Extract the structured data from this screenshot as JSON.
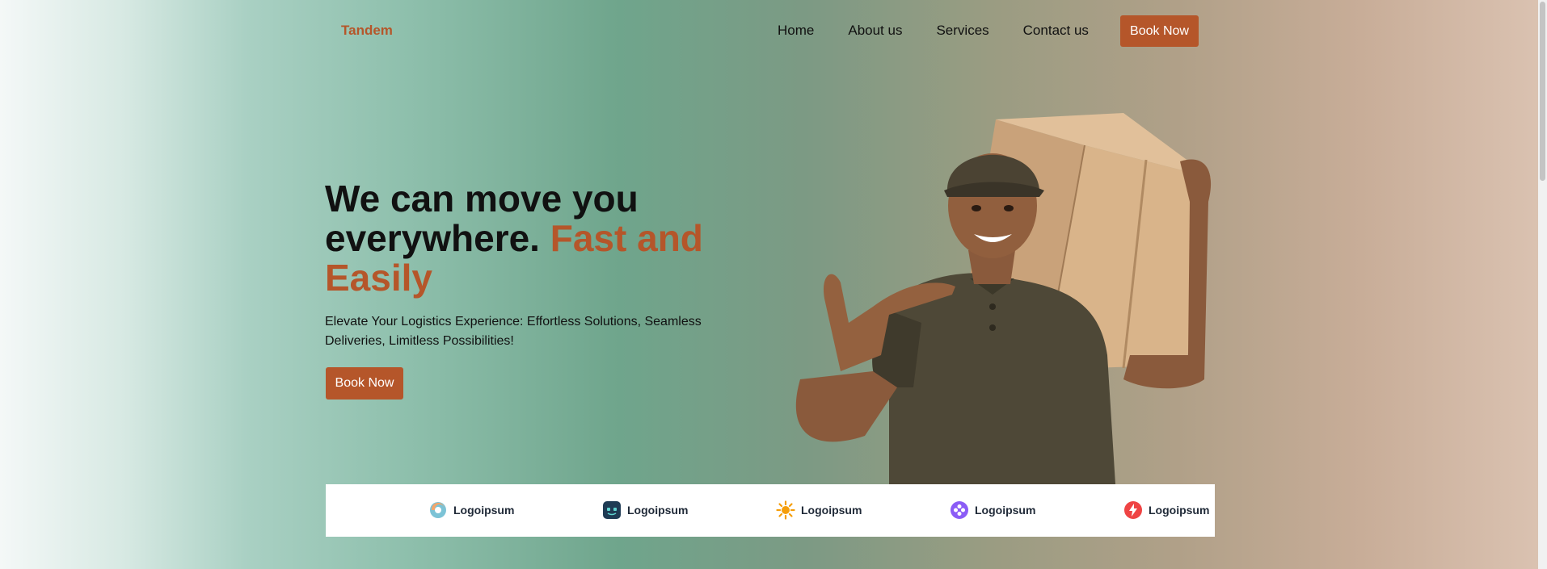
{
  "nav": {
    "brand": "Tandem",
    "links": [
      "Home",
      "About us",
      "Services",
      "Contact us"
    ],
    "cta": "Book Now"
  },
  "hero": {
    "title_part1": "We can move you everywhere.",
    "title_accent": "Fast and Easily",
    "subtitle": "Elevate Your Logistics Experience: Effortless Solutions, Seamless Deliveries, Limitless Possibilities!",
    "cta": "Book Now"
  },
  "logos": {
    "items": [
      {
        "name": "Logoipsum",
        "icon": "swirl-logo-icon"
      },
      {
        "name": "Logoipsum",
        "icon": "face-logo-icon"
      },
      {
        "name": "Logoipsum",
        "icon": "sun-logo-icon"
      },
      {
        "name": "Logoipsum",
        "icon": "dots-logo-icon"
      },
      {
        "name": "Logoipsum",
        "icon": "bolt-logo-icon"
      }
    ]
  },
  "colors": {
    "accent": "#b5562a",
    "text": "#111111"
  }
}
